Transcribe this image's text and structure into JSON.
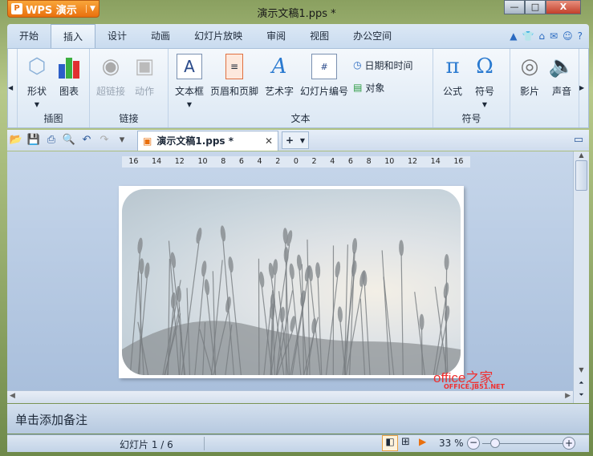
{
  "app": {
    "name": "WPS 演示",
    "title": "演示文稿1.pps *"
  },
  "window_buttons": {
    "minimize": "—",
    "maximize": "□",
    "close": "X"
  },
  "tabs": [
    {
      "label": "开始"
    },
    {
      "label": "插入",
      "active": true
    },
    {
      "label": "设计"
    },
    {
      "label": "动画"
    },
    {
      "label": "幻灯片放映"
    },
    {
      "label": "审阅"
    },
    {
      "label": "视图"
    },
    {
      "label": "办公空间"
    }
  ],
  "ribbon": {
    "groups": [
      {
        "label": "插图",
        "buttons": [
          {
            "label": "形状",
            "icon": "shapes-icon"
          },
          {
            "label": "图表",
            "icon": "chart-icon"
          }
        ]
      },
      {
        "label": "链接",
        "buttons": [
          {
            "label": "超链接",
            "icon": "hyperlink-icon",
            "disabled": true
          },
          {
            "label": "动作",
            "icon": "action-icon",
            "disabled": true
          }
        ]
      },
      {
        "label": "文本",
        "buttons": [
          {
            "label": "文本框",
            "icon": "textbox-icon"
          },
          {
            "label": "页眉和页脚",
            "icon": "header-footer-icon"
          },
          {
            "label": "艺术字",
            "icon": "wordart-icon"
          },
          {
            "label": "幻灯片编号",
            "icon": "slide-number-icon"
          }
        ],
        "small": [
          {
            "label": "日期和时间",
            "icon": "date-time-icon"
          },
          {
            "label": "对象",
            "icon": "object-icon"
          }
        ]
      },
      {
        "label": "符号",
        "buttons": [
          {
            "label": "公式",
            "icon": "pi-icon"
          },
          {
            "label": "符号",
            "icon": "omega-icon"
          }
        ]
      },
      {
        "label": "",
        "buttons": [
          {
            "label": "影片",
            "icon": "film-icon"
          },
          {
            "label": "声音",
            "icon": "speaker-icon"
          }
        ]
      }
    ]
  },
  "doc_tab": {
    "label": "演示文稿1.pps *"
  },
  "ruler": [
    "16",
    "14",
    "12",
    "10",
    "8",
    "6",
    "4",
    "2",
    "0",
    "2",
    "4",
    "6",
    "8",
    "10",
    "12",
    "14",
    "16"
  ],
  "watermark": {
    "brand": "office之家",
    "url": "OFFICE.JB51.NET"
  },
  "notes": {
    "placeholder": "单击添加备注"
  },
  "status": {
    "slide": "幻灯片 1 / 6",
    "zoom": "33 %",
    "zoom_percent": 33
  },
  "colors": {
    "accent": "#e9700e",
    "ribbon": "#dce8f4"
  }
}
